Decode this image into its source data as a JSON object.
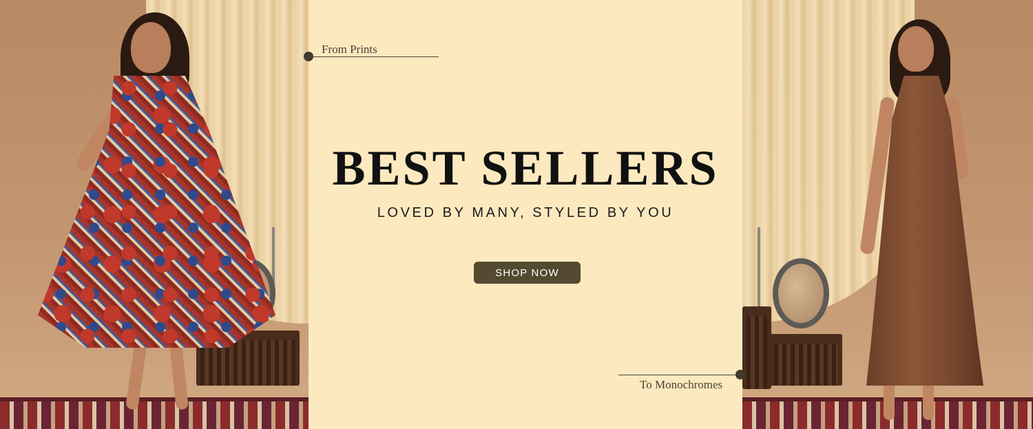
{
  "hero": {
    "title": "BEST SELLERS",
    "subtitle": "LOVED BY MANY, STYLED BY YOU",
    "cta_label": "SHOP NOW",
    "tag_left": "From Prints",
    "tag_right": "To Monochromes"
  },
  "colors": {
    "panel_background": "#fde9c0",
    "button_background": "#534a31",
    "button_text": "#ffffff",
    "accent_dark": "#3f3a2a"
  },
  "images": {
    "left": "model-in-printed-dress",
    "right": "model-in-brown-kurta-set"
  }
}
